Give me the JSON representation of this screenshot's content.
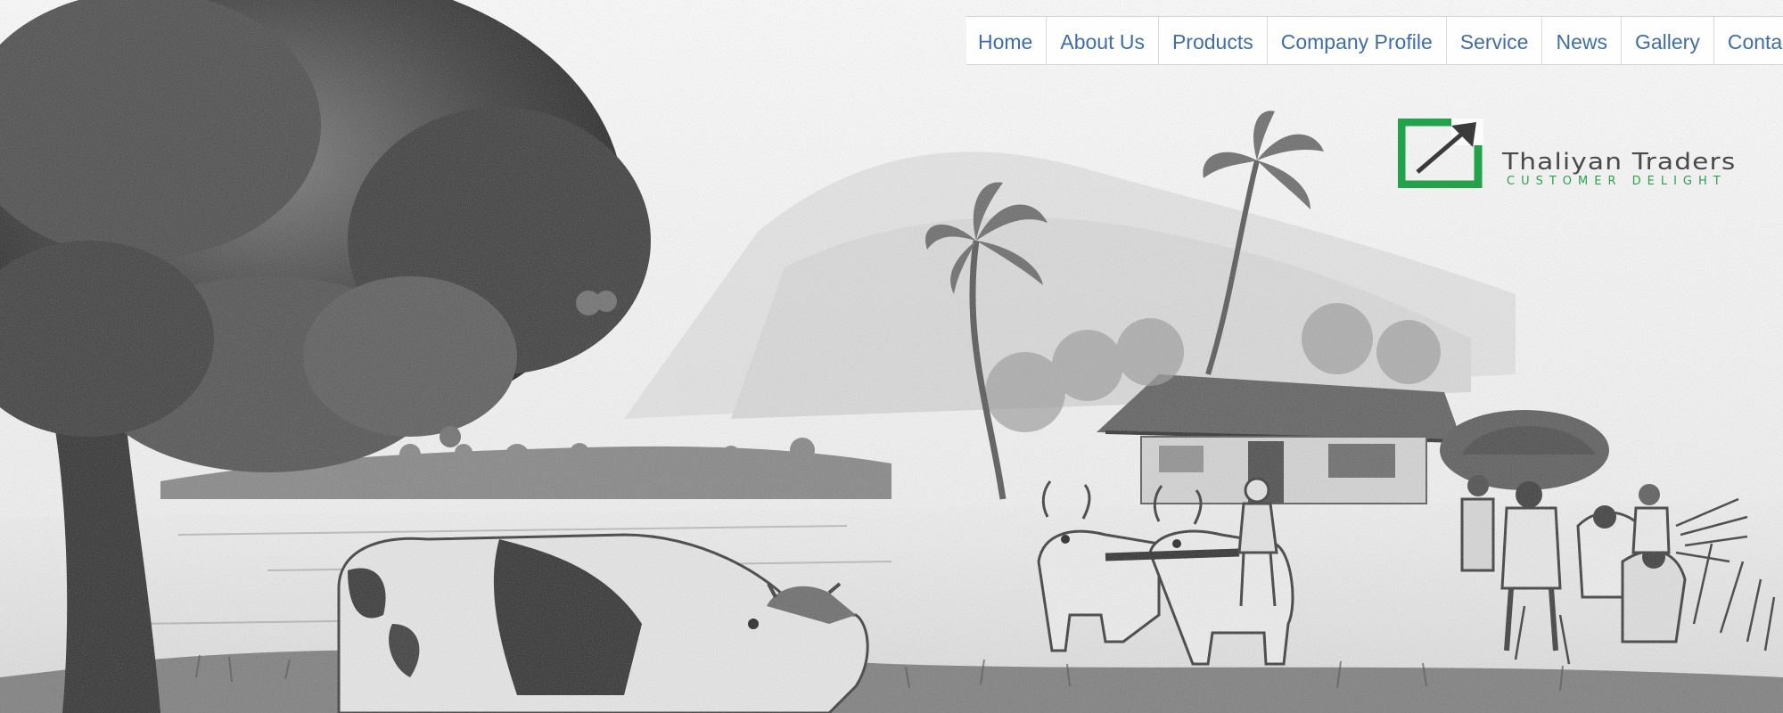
{
  "nav": {
    "items": [
      {
        "label": "Home"
      },
      {
        "label": "About Us"
      },
      {
        "label": "Products"
      },
      {
        "label": "Company Profile"
      },
      {
        "label": "Service"
      },
      {
        "label": "News"
      },
      {
        "label": "Gallery"
      },
      {
        "label": "Contact"
      }
    ]
  },
  "brand": {
    "name": "Thaliyan Traders",
    "tagline": "CUSTOMER DELIGHT",
    "colors": {
      "green": "#21a24b",
      "arrow": "#3b3b3b",
      "nav_link": "#3f6ea6"
    }
  },
  "hero": {
    "type": "pencil-sketch-illustration",
    "description_icons": [
      "tree-illustration",
      "cow-illustration",
      "ox-cart-illustration",
      "palm-tree-illustration",
      "hut-illustration",
      "farmers-illustration"
    ]
  }
}
